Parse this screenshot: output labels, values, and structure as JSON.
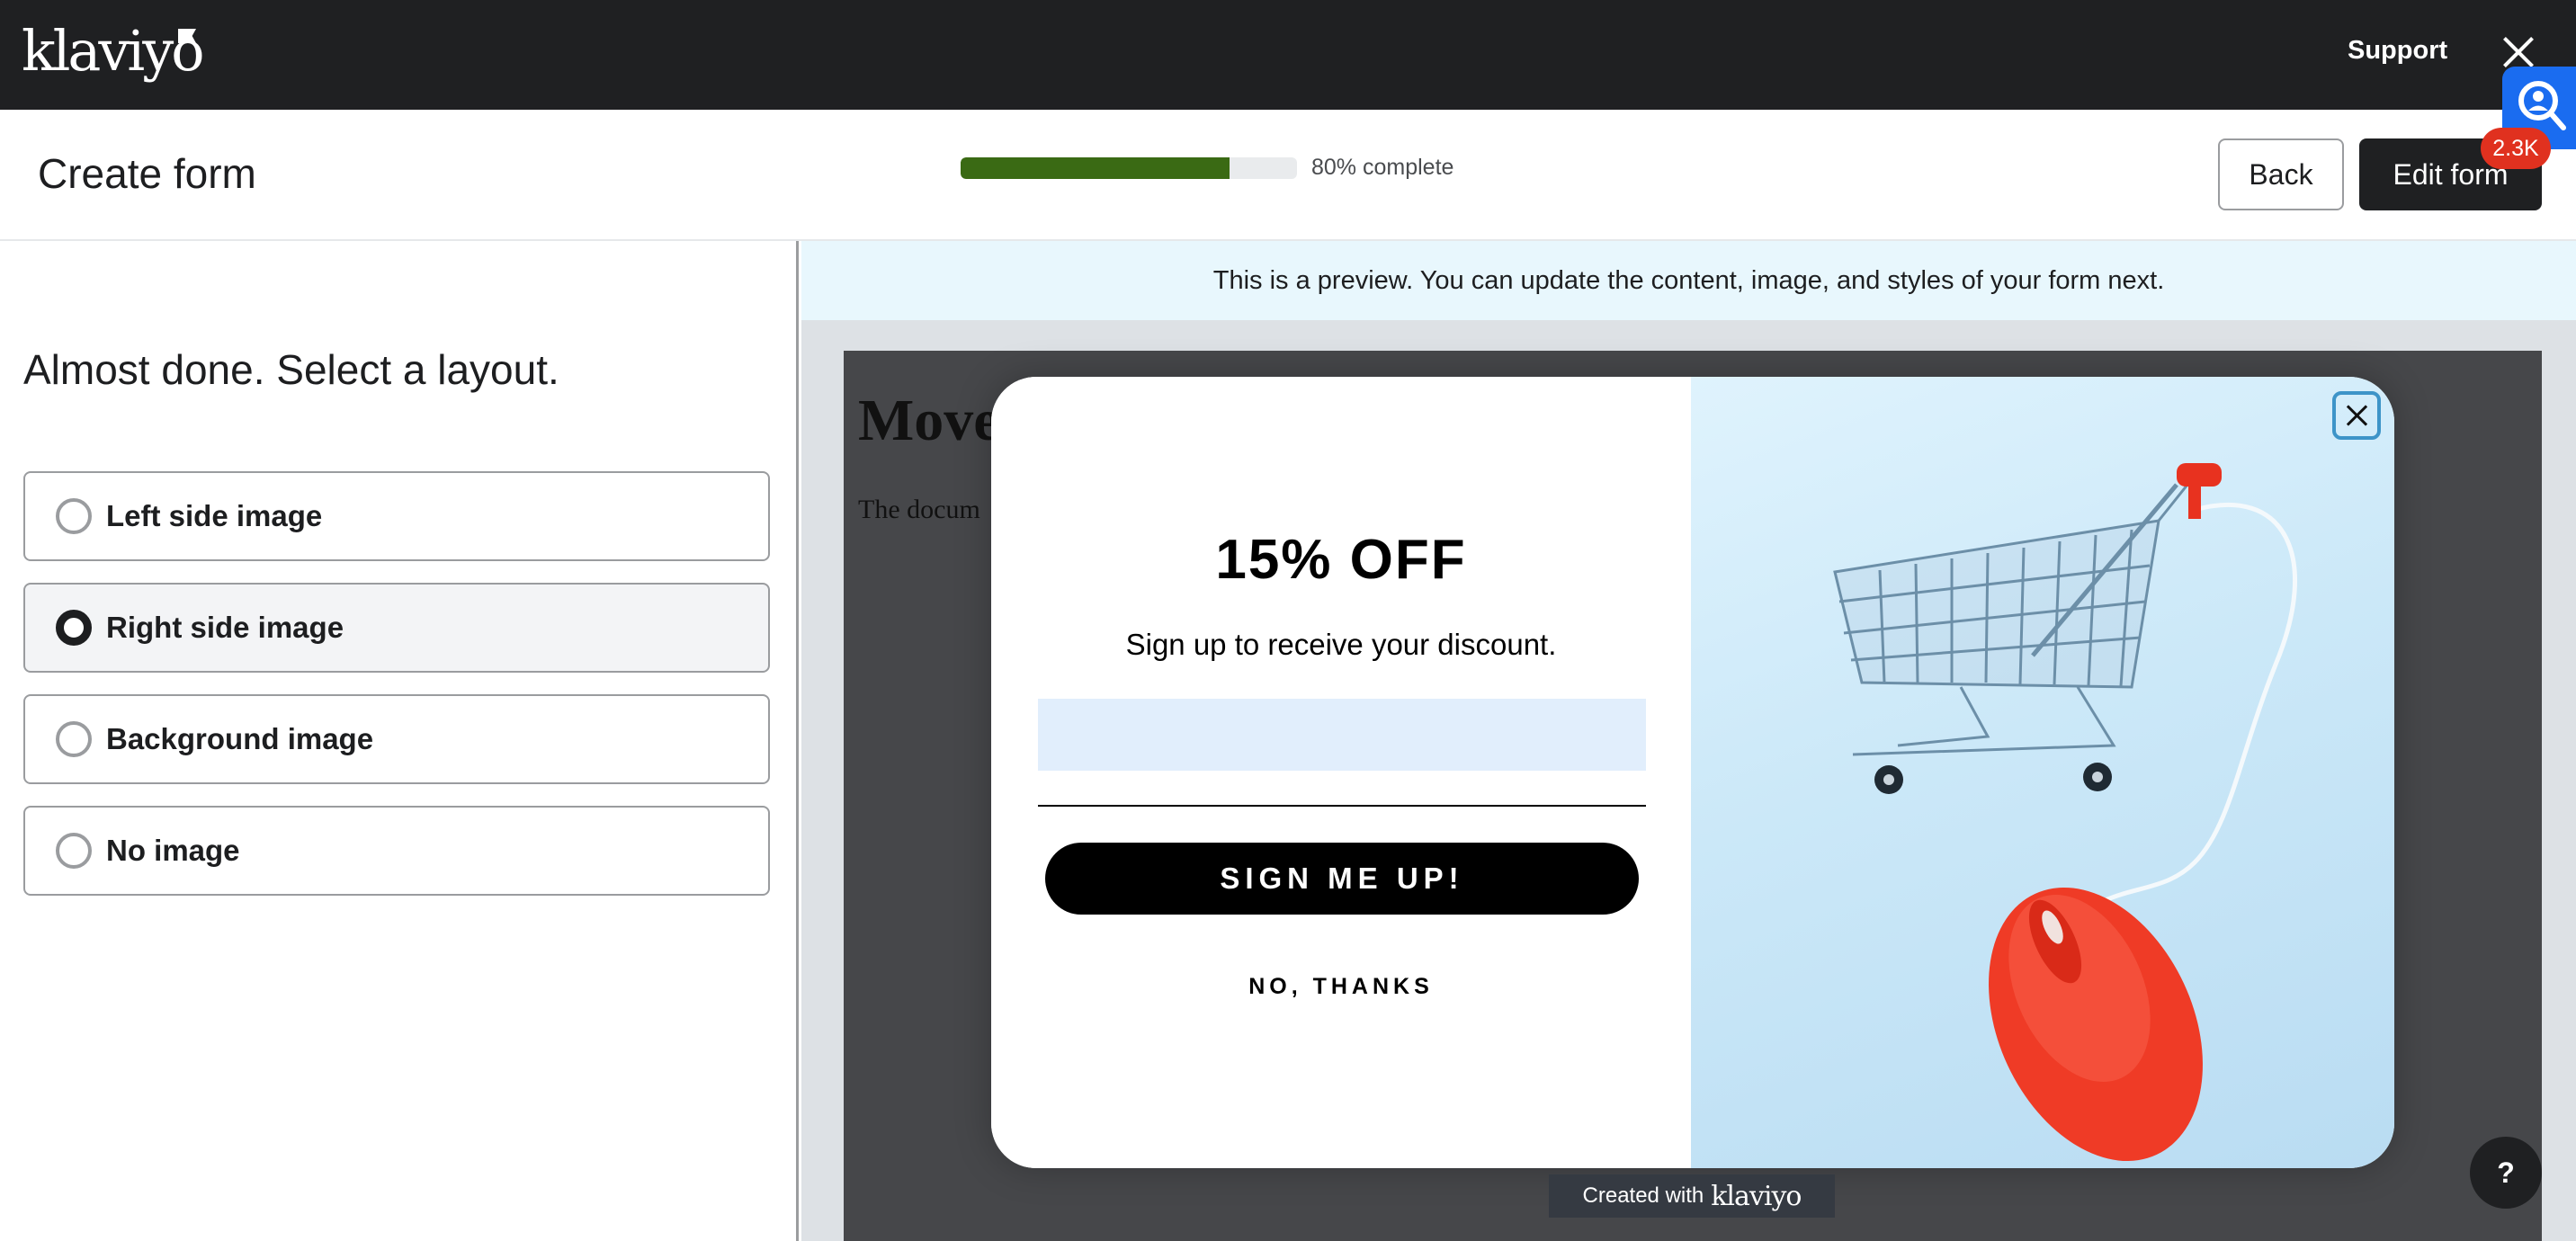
{
  "topbar": {
    "logo": "klaviyo",
    "support_label": "Support"
  },
  "header": {
    "title": "Create form",
    "progress": {
      "percent": 80,
      "label": "80% complete"
    },
    "back_label": "Back",
    "edit_label": "Edit form"
  },
  "extension": {
    "icon": "user-search-icon",
    "badge": "2.3K"
  },
  "left_panel": {
    "title": "Almost done. Select a layout.",
    "options": [
      {
        "label": "Left side image",
        "selected": false
      },
      {
        "label": "Right side image",
        "selected": true
      },
      {
        "label": "Background image",
        "selected": false
      },
      {
        "label": "No image",
        "selected": false
      }
    ]
  },
  "preview": {
    "banner": "This is a preview. You can update the content, image, and styles of your form next.",
    "site_heading": "Move",
    "site_text": "The docum",
    "modal": {
      "title": "15% OFF",
      "subtitle": "Sign up to receive your discount.",
      "email_value": "",
      "submit_label": "SIGN ME UP!",
      "decline_label": "NO, THANKS",
      "image_alt": "Shopping cart connected to red computer mouse"
    },
    "created_with": "Created with",
    "created_logo": "klaviyo",
    "help_label": "?"
  },
  "colors": {
    "topbar_bg": "#1f2022",
    "progress_fill": "#3a6a14",
    "banner_bg": "#e8f7fd",
    "badge_red": "#e0311f",
    "extension_blue": "#1a6cf0"
  }
}
